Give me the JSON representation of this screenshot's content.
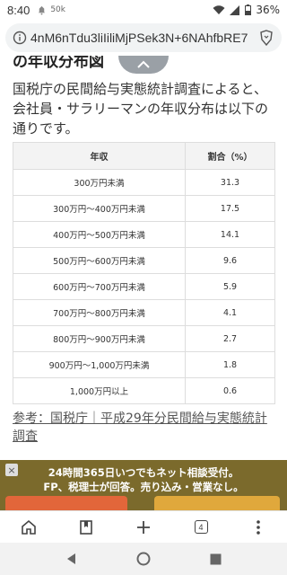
{
  "status_bar": {
    "time": "8:40",
    "notif_label": "50k",
    "battery": "36%"
  },
  "browser": {
    "url": "4nM6nTdu3liIiliMjPSek3N+6NAhfbRE7"
  },
  "article": {
    "heading_fragment": "の年収分布図",
    "paragraph": "国税庁の民間給与実態統計調査によると、会社員・サラリーマンの年収分布は以下の通りです。",
    "table": {
      "headers": [
        "年収",
        "割合（%）"
      ],
      "rows": [
        [
          "300万円未満",
          "31.3"
        ],
        [
          "300万円～400万円未満",
          "17.5"
        ],
        [
          "400万円～500万円未満",
          "14.1"
        ],
        [
          "500万円～600万円未満",
          "9.6"
        ],
        [
          "600万円～700万円未満",
          "5.9"
        ],
        [
          "700万円～800万円未満",
          "4.1"
        ],
        [
          "800万円～900万円未満",
          "2.7"
        ],
        [
          "900万円～1,000万円未満",
          "1.8"
        ],
        [
          "1,000万円以上",
          "0.6"
        ]
      ]
    },
    "reference": "参考：国税庁｜平成29年分民間給与実態統計調査"
  },
  "banner": {
    "close_label": "×",
    "line1": "24時間365日いつでもネット相談受付。",
    "line2": "FP、税理士が回答。売り込み・営業なし。"
  },
  "toolbar": {
    "tab_count": "4"
  },
  "colors": {
    "banner_bg": "#7b6a2c",
    "button_left": "#e2663a",
    "button_right": "#e0a83c"
  }
}
